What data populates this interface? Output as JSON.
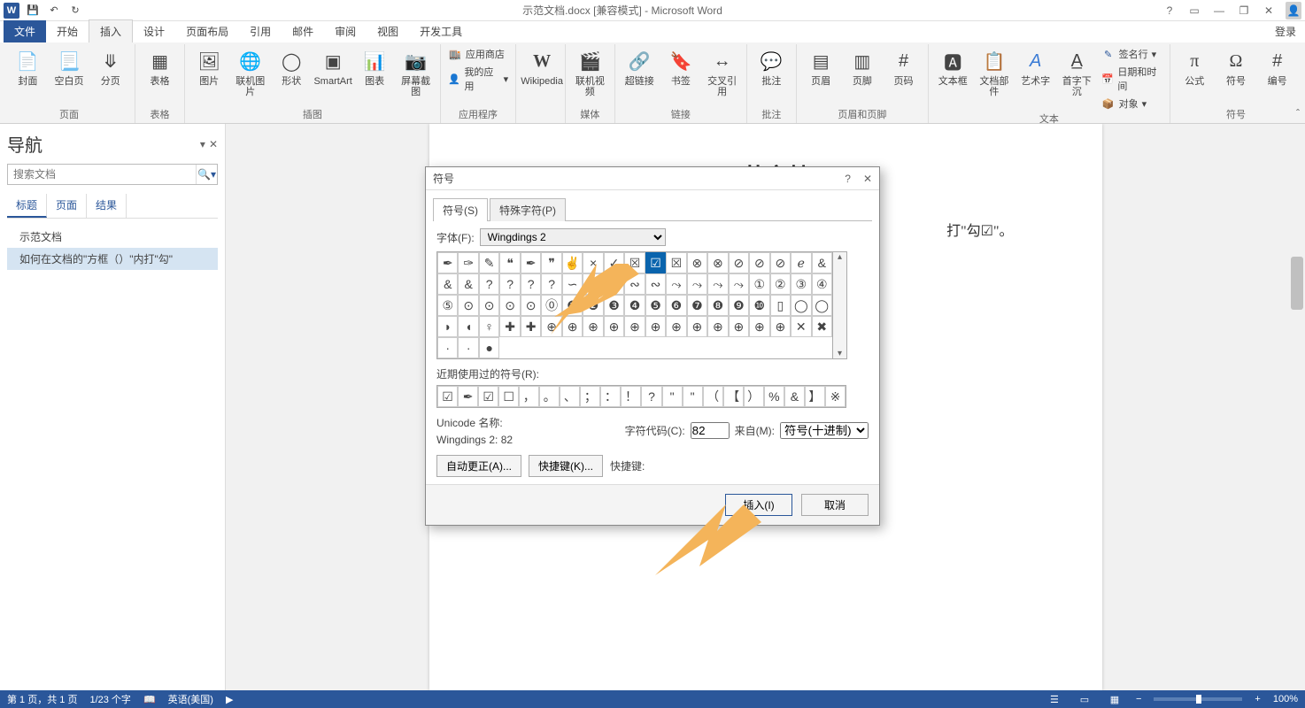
{
  "titlebar": {
    "title": "示范文档.docx [兼容模式] - Microsoft Word",
    "qat_save": "💾",
    "qat_undo": "↶",
    "qat_redo": "↻"
  },
  "tabs": {
    "file": "文件",
    "home": "开始",
    "insert": "插入",
    "design": "设计",
    "layout": "页面布局",
    "references": "引用",
    "mailings": "邮件",
    "review": "审阅",
    "view": "视图",
    "developer": "开发工具",
    "login": "登录"
  },
  "ribbon": {
    "pages": {
      "label": "页面",
      "cover": "封面",
      "blank": "空白页",
      "break": "分页"
    },
    "tables": {
      "label": "表格",
      "table": "表格"
    },
    "illus": {
      "label": "插图",
      "pic": "图片",
      "online": "联机图片",
      "shapes": "形状",
      "smartart": "SmartArt",
      "chart": "图表",
      "screenshot": "屏幕截图"
    },
    "apps": {
      "label": "应用程序",
      "store": "应用商店",
      "myapps": "我的应用"
    },
    "wiki": {
      "label": "",
      "wikipedia": "Wikipedia"
    },
    "media": {
      "label": "媒体",
      "video": "联机视频"
    },
    "links": {
      "label": "链接",
      "hyperlink": "超链接",
      "bookmark": "书签",
      "crossref": "交叉引用"
    },
    "comments": {
      "label": "批注",
      "comment": "批注"
    },
    "hf": {
      "label": "页眉和页脚",
      "header": "页眉",
      "footer": "页脚",
      "pagenum": "页码"
    },
    "text": {
      "label": "文本",
      "textbox": "文本框",
      "parts": "文档部件",
      "wordart": "艺术字",
      "dropcap": "首字下沉",
      "sig": "签名行",
      "datetime": "日期和时间",
      "object": "对象"
    },
    "symbols": {
      "label": "符号",
      "equation": "公式",
      "symbol": "符号",
      "number": "编号"
    }
  },
  "nav": {
    "title": "导航",
    "placeholder": "搜索文档",
    "tabs": {
      "headings": "标题",
      "pages": "页面",
      "results": "结果"
    },
    "items": [
      "示范文档",
      "如何在文档的\"方框（）\"内打\"勾\""
    ]
  },
  "doc": {
    "h1": "示范文档",
    "line": "打\"勾☑\"。"
  },
  "dialog": {
    "title": "符号",
    "tab_symbols": "符号(S)",
    "tab_special": "特殊字符(P)",
    "font_label": "字体(F):",
    "font_value": "Wingdings 2",
    "grid": [
      [
        "✒",
        "✑",
        "✎",
        "❝",
        "✒",
        "❞",
        "✌",
        "×",
        "✓",
        "☒",
        "☑",
        "☒",
        "⊗",
        "⊗",
        "⊘",
        "⊘",
        "⊘",
        "ℯ",
        "&"
      ],
      [
        "&",
        "&",
        "?",
        "?",
        "?",
        "?",
        "∽",
        "∽",
        "∽",
        "∾",
        "∾",
        "⤳",
        "⤳",
        "⤳",
        "⤳",
        "①",
        "②",
        "③",
        "④",
        "⑤"
      ],
      [
        "⊙",
        "⊙",
        "⊙",
        "⊙",
        "⓪",
        "❶",
        "❷",
        "❸",
        "❹",
        "❺",
        "❻",
        "❼",
        "❽",
        "❾",
        "❿",
        "▯",
        "◯",
        "◯",
        "◗",
        "◖"
      ],
      [
        "♀",
        "✚",
        "✚",
        "⊕",
        "⊕",
        "⊕",
        "⊕",
        "⊕",
        "⊕",
        "⊕",
        "⊕",
        "⊕",
        "⊕",
        "⊕",
        "⊕",
        "✕",
        "✖",
        "·",
        "·",
        "●"
      ]
    ],
    "selected_row": 0,
    "selected_col": 10,
    "recent_label": "近期使用过的符号(R):",
    "recent": [
      "☑",
      "✒",
      "☑",
      "☐",
      "，",
      "。",
      "、",
      "；",
      "：",
      "！",
      "?",
      "\"",
      "\"",
      "（",
      "【",
      "）",
      "%",
      "&",
      "】",
      "※"
    ],
    "unicode_name_label": "Unicode 名称:",
    "unicode_name": "Wingdings 2: 82",
    "charcode_label": "字符代码(C):",
    "charcode_value": "82",
    "from_label": "来自(M):",
    "from_value": "符号(十进制)",
    "autocorrect": "自动更正(A)...",
    "shortcut": "快捷键(K)...",
    "shortcut_label": "快捷键:",
    "insert": "插入(I)",
    "cancel": "取消"
  },
  "status": {
    "page": "第 1 页，共 1 页",
    "words": "1/23 个字",
    "lang": "英语(美国)",
    "zoom": "100%"
  }
}
